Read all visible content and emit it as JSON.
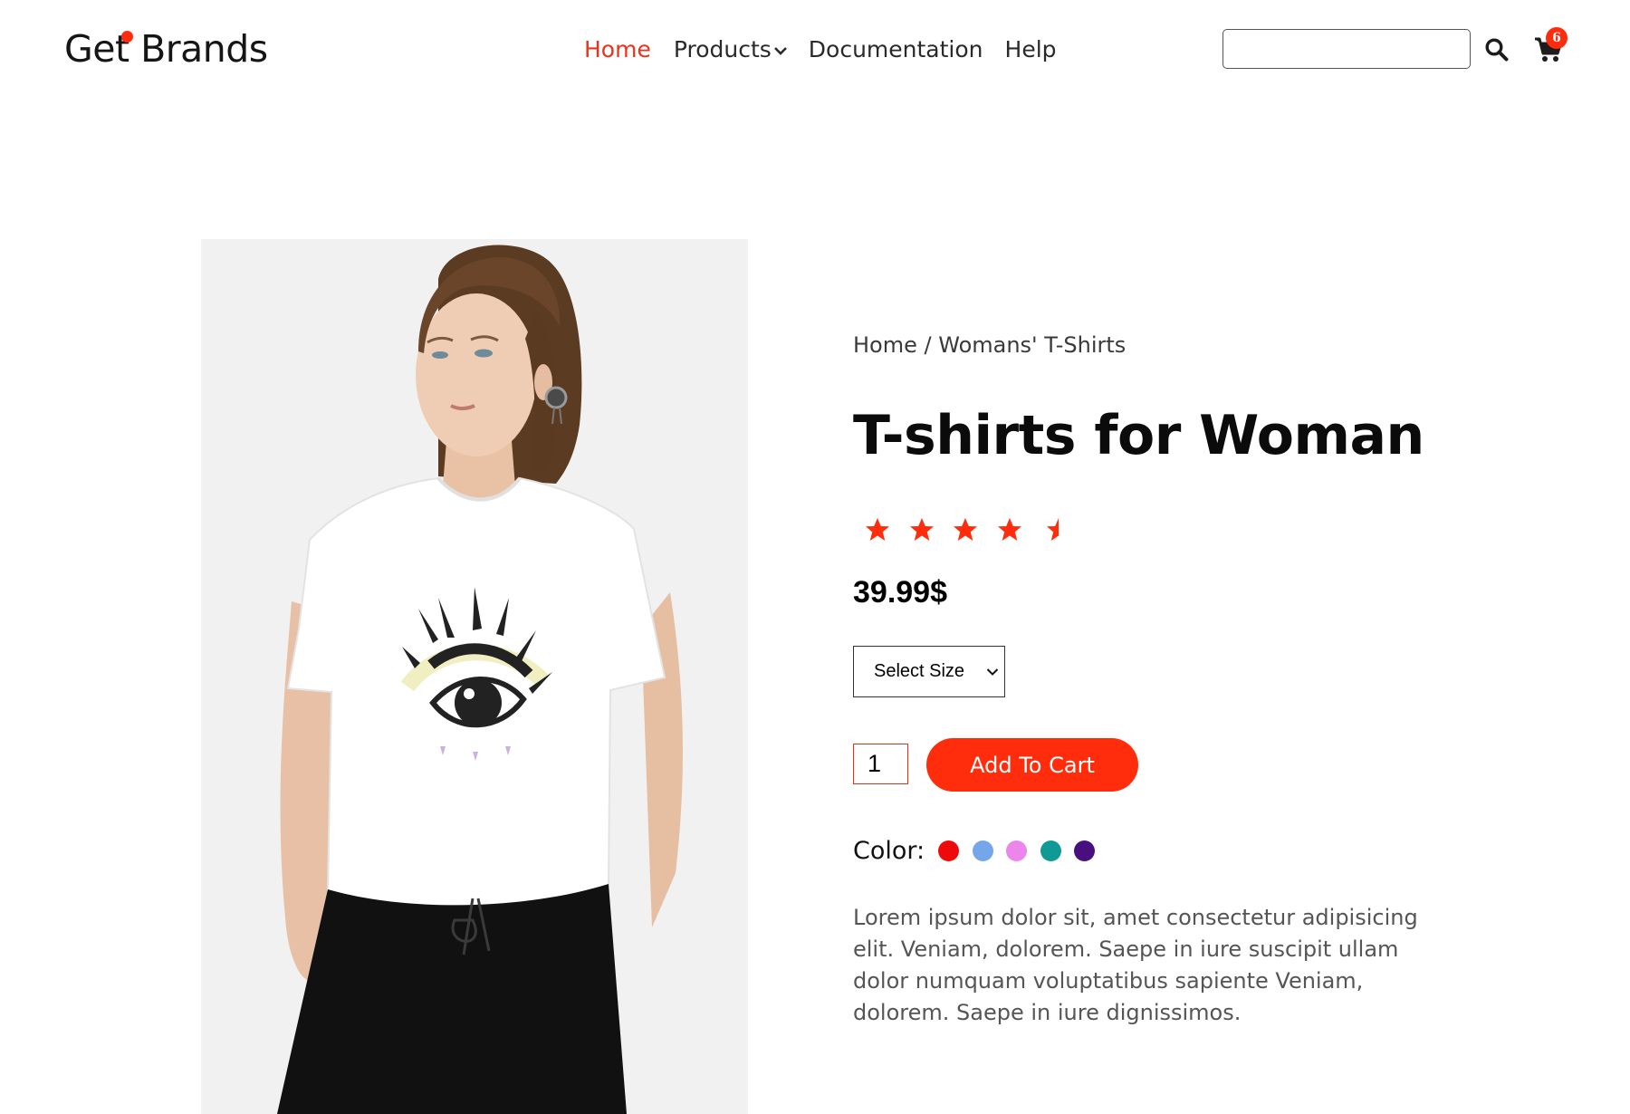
{
  "header": {
    "logo_text": "Get Brands",
    "nav": [
      {
        "label": "Home",
        "active": true
      },
      {
        "label": "Products",
        "has_dropdown": true
      },
      {
        "label": "Documentation"
      },
      {
        "label": "Help"
      }
    ],
    "search": {
      "value": "",
      "placeholder": ""
    },
    "search_icon": "search-icon",
    "cart_icon": "cart-icon",
    "cart_count": "6"
  },
  "product": {
    "image": "woman wearing white t-shirt with eye print and black pants",
    "breadcrumb": {
      "home": "Home",
      "separator": "/",
      "category": "Womans' T-Shirts"
    },
    "title": "T-shirts for Woman",
    "rating": 4.5,
    "price": "39.99$",
    "size_select": {
      "selected": "Select Size"
    },
    "quantity": "1",
    "add_to_cart_label": "Add To Cart",
    "color_label": "Color:",
    "colors": [
      "#ee0a0a",
      "#75a6ea",
      "#ec85ec",
      "#109a95",
      "#4a0f7e"
    ],
    "description": "Lorem ipsum dolor sit, amet consectetur adipisicing elit. Veniam, dolorem. Saepe in iure suscipit ullam dolor numquam voluptatibus sapiente Veniam, dolorem. Saepe in iure dignissimos."
  },
  "theme": {
    "accent": "#ff2d0c",
    "text": "#111111"
  }
}
